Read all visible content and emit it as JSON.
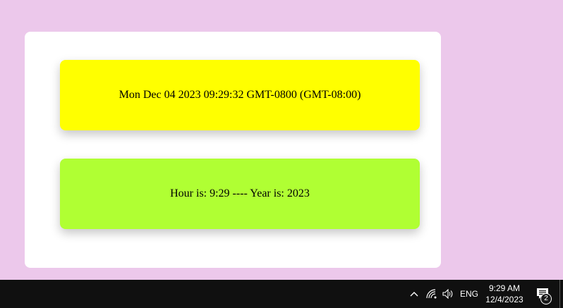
{
  "colors": {
    "desktop_background": "#ecc8eb",
    "card_background": "#ffffff",
    "date_panel": "#ffff00",
    "time_panel": "#b0ff33",
    "taskbar": "#101010"
  },
  "panels": {
    "date_text": "Mon Dec 04 2023 09:29:32 GMT-0800 (GMT-08:00)",
    "time_text": "Hour is: 9:29 ---- Year is: 2023"
  },
  "taskbar": {
    "tray_icons": [
      "chevron-up-icon",
      "network-icon",
      "volume-icon"
    ],
    "language": "ENG",
    "time": "9:29 AM",
    "date": "12/4/2023",
    "notification_count": "2"
  }
}
